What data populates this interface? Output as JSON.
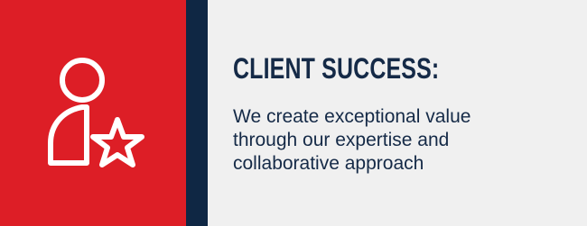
{
  "icon": "client-star-icon",
  "heading": "CLIENT SUCCESS:",
  "body": "We create exceptional value through our expertise and collaborative approach",
  "colors": {
    "red_panel": "#dd1e26",
    "navy_stripe": "#0f2744",
    "background": "#f0f0f0",
    "text": "#152a47"
  }
}
